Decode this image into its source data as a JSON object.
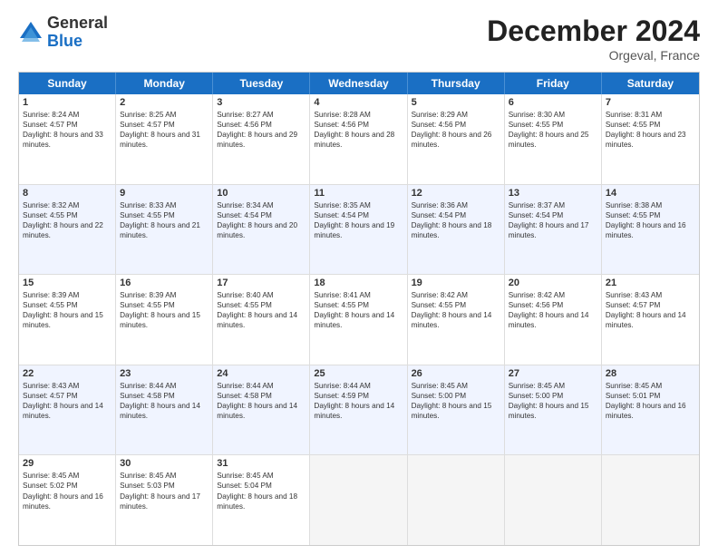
{
  "logo": {
    "general": "General",
    "blue": "Blue"
  },
  "header": {
    "month": "December 2024",
    "location": "Orgeval, France"
  },
  "days": [
    "Sunday",
    "Monday",
    "Tuesday",
    "Wednesday",
    "Thursday",
    "Friday",
    "Saturday"
  ],
  "weeks": [
    [
      {
        "day": "1",
        "sunrise": "8:24 AM",
        "sunset": "4:57 PM",
        "daylight": "8 hours and 33 minutes."
      },
      {
        "day": "2",
        "sunrise": "8:25 AM",
        "sunset": "4:57 PM",
        "daylight": "8 hours and 31 minutes."
      },
      {
        "day": "3",
        "sunrise": "8:27 AM",
        "sunset": "4:56 PM",
        "daylight": "8 hours and 29 minutes."
      },
      {
        "day": "4",
        "sunrise": "8:28 AM",
        "sunset": "4:56 PM",
        "daylight": "8 hours and 28 minutes."
      },
      {
        "day": "5",
        "sunrise": "8:29 AM",
        "sunset": "4:56 PM",
        "daylight": "8 hours and 26 minutes."
      },
      {
        "day": "6",
        "sunrise": "8:30 AM",
        "sunset": "4:55 PM",
        "daylight": "8 hours and 25 minutes."
      },
      {
        "day": "7",
        "sunrise": "8:31 AM",
        "sunset": "4:55 PM",
        "daylight": "8 hours and 23 minutes."
      }
    ],
    [
      {
        "day": "8",
        "sunrise": "8:32 AM",
        "sunset": "4:55 PM",
        "daylight": "8 hours and 22 minutes."
      },
      {
        "day": "9",
        "sunrise": "8:33 AM",
        "sunset": "4:55 PM",
        "daylight": "8 hours and 21 minutes."
      },
      {
        "day": "10",
        "sunrise": "8:34 AM",
        "sunset": "4:54 PM",
        "daylight": "8 hours and 20 minutes."
      },
      {
        "day": "11",
        "sunrise": "8:35 AM",
        "sunset": "4:54 PM",
        "daylight": "8 hours and 19 minutes."
      },
      {
        "day": "12",
        "sunrise": "8:36 AM",
        "sunset": "4:54 PM",
        "daylight": "8 hours and 18 minutes."
      },
      {
        "day": "13",
        "sunrise": "8:37 AM",
        "sunset": "4:54 PM",
        "daylight": "8 hours and 17 minutes."
      },
      {
        "day": "14",
        "sunrise": "8:38 AM",
        "sunset": "4:55 PM",
        "daylight": "8 hours and 16 minutes."
      }
    ],
    [
      {
        "day": "15",
        "sunrise": "8:39 AM",
        "sunset": "4:55 PM",
        "daylight": "8 hours and 15 minutes."
      },
      {
        "day": "16",
        "sunrise": "8:39 AM",
        "sunset": "4:55 PM",
        "daylight": "8 hours and 15 minutes."
      },
      {
        "day": "17",
        "sunrise": "8:40 AM",
        "sunset": "4:55 PM",
        "daylight": "8 hours and 14 minutes."
      },
      {
        "day": "18",
        "sunrise": "8:41 AM",
        "sunset": "4:55 PM",
        "daylight": "8 hours and 14 minutes."
      },
      {
        "day": "19",
        "sunrise": "8:42 AM",
        "sunset": "4:55 PM",
        "daylight": "8 hours and 14 minutes."
      },
      {
        "day": "20",
        "sunrise": "8:42 AM",
        "sunset": "4:56 PM",
        "daylight": "8 hours and 14 minutes."
      },
      {
        "day": "21",
        "sunrise": "8:43 AM",
        "sunset": "4:57 PM",
        "daylight": "8 hours and 14 minutes."
      }
    ],
    [
      {
        "day": "22",
        "sunrise": "8:43 AM",
        "sunset": "4:57 PM",
        "daylight": "8 hours and 14 minutes."
      },
      {
        "day": "23",
        "sunrise": "8:44 AM",
        "sunset": "4:58 PM",
        "daylight": "8 hours and 14 minutes."
      },
      {
        "day": "24",
        "sunrise": "8:44 AM",
        "sunset": "4:58 PM",
        "daylight": "8 hours and 14 minutes."
      },
      {
        "day": "25",
        "sunrise": "8:44 AM",
        "sunset": "4:59 PM",
        "daylight": "8 hours and 14 minutes."
      },
      {
        "day": "26",
        "sunrise": "8:45 AM",
        "sunset": "5:00 PM",
        "daylight": "8 hours and 15 minutes."
      },
      {
        "day": "27",
        "sunrise": "8:45 AM",
        "sunset": "5:00 PM",
        "daylight": "8 hours and 15 minutes."
      },
      {
        "day": "28",
        "sunrise": "8:45 AM",
        "sunset": "5:01 PM",
        "daylight": "8 hours and 16 minutes."
      }
    ],
    [
      {
        "day": "29",
        "sunrise": "8:45 AM",
        "sunset": "5:02 PM",
        "daylight": "8 hours and 16 minutes."
      },
      {
        "day": "30",
        "sunrise": "8:45 AM",
        "sunset": "5:03 PM",
        "daylight": "8 hours and 17 minutes."
      },
      {
        "day": "31",
        "sunrise": "8:45 AM",
        "sunset": "5:04 PM",
        "daylight": "8 hours and 18 minutes."
      },
      null,
      null,
      null,
      null
    ]
  ]
}
